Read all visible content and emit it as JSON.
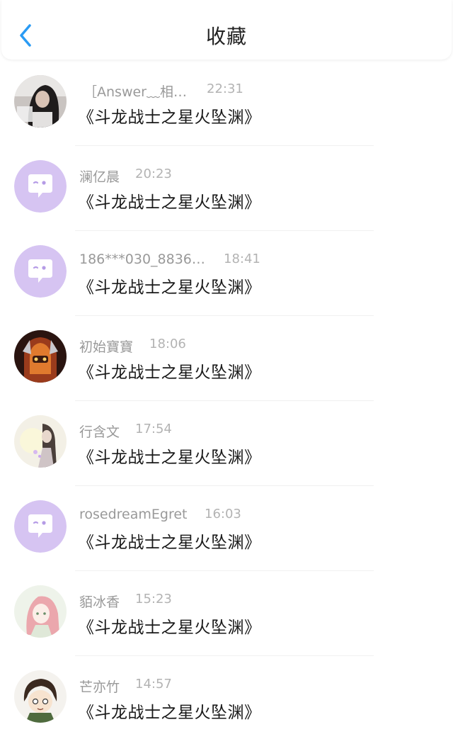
{
  "header": {
    "title": "收藏",
    "back_icon": "chevron-left-icon",
    "accent_color": "#2a9bf4"
  },
  "items": [
    {
      "avatar": "girl-photo-avatar",
      "username": "［Answer﹏相…",
      "time": "22:31",
      "message": "《斗龙战士之星火坠渊》"
    },
    {
      "avatar": "default-chat-bubble-avatar",
      "username": "澜亿晨",
      "time": "20:23",
      "message": "《斗龙战士之星火坠渊》"
    },
    {
      "avatar": "default-chat-bubble-avatar",
      "username": "186***030_8836…",
      "time": "18:41",
      "message": "《斗龙战士之星火坠渊》"
    },
    {
      "avatar": "helmet-character-avatar",
      "username": "初始寶寶",
      "time": "18:06",
      "message": "《斗龙战士之星火坠渊》"
    },
    {
      "avatar": "anime-girl-avatar",
      "username": "行含文",
      "time": "17:54",
      "message": "《斗龙战士之星火坠渊》"
    },
    {
      "avatar": "default-chat-bubble-avatar",
      "username": "rosedreamEgret",
      "time": "16:03",
      "message": "《斗龙战士之星火坠渊》"
    },
    {
      "avatar": "pink-hair-girl-avatar",
      "username": "貊冰香",
      "time": "15:23",
      "message": "《斗龙战士之星火坠渊》"
    },
    {
      "avatar": "chibi-boy-avatar",
      "username": "芒亦竹",
      "time": "14:57",
      "message": "《斗龙战士之星火坠渊》"
    }
  ],
  "colors": {
    "default_avatar_bg": "#d6c4f2",
    "username": "#999999",
    "time": "#b3b3b3",
    "message": "#1a1a1a"
  }
}
